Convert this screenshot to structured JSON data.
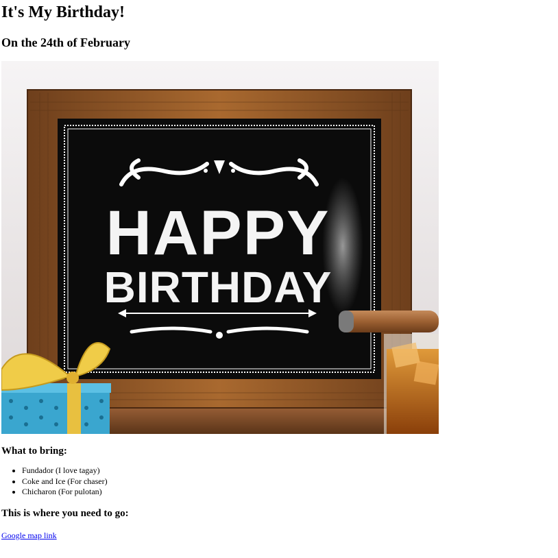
{
  "page": {
    "title": "It's My Birthday!",
    "subtitle": "On the 24th of February"
  },
  "image": {
    "alt": "Happy Birthday chalkboard",
    "board_line1": "HAPPY",
    "board_line2": "BIRTHDAY",
    "colors": {
      "wall": "#f1eef0",
      "frame": "#9a5a2a",
      "board": "#0b0b0b",
      "gift": "#3aa6cf",
      "ribbon": "#e8c040",
      "cigar": "#a4683a",
      "whiskey": "#c9721a"
    }
  },
  "bring": {
    "heading": "What to bring:",
    "items": [
      "Fundador (I love tagay)",
      "Coke and Ice (For chaser)",
      "Chicharon (For pulotan)"
    ]
  },
  "location": {
    "heading": "This is where you need to go:",
    "link_label": "Google map link"
  }
}
